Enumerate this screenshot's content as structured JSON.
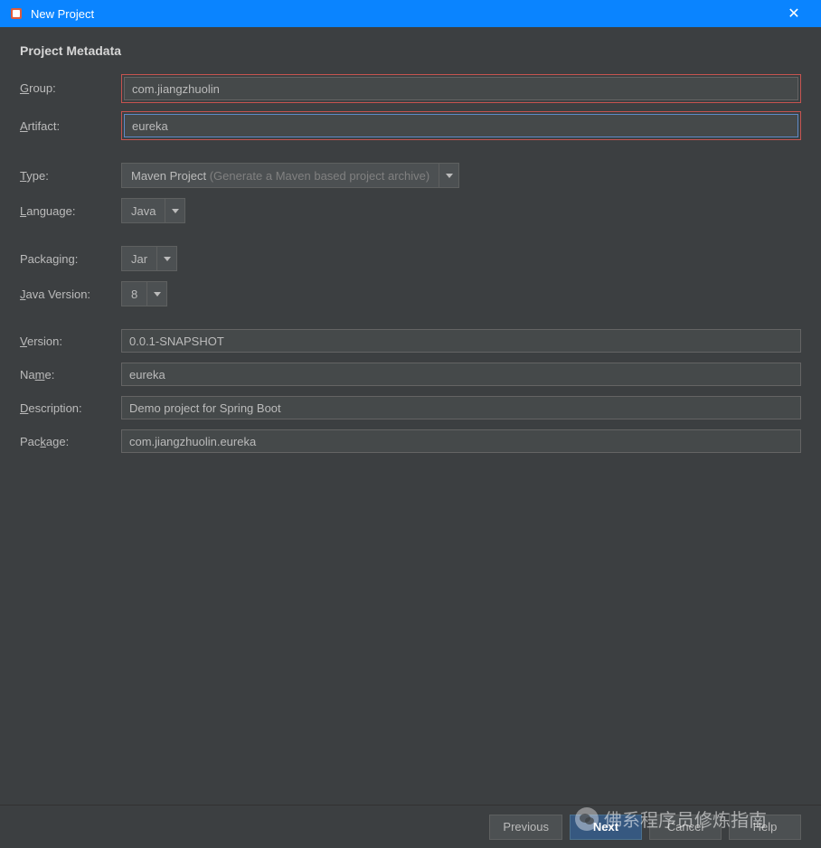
{
  "window": {
    "title": "New Project"
  },
  "section": {
    "title": "Project Metadata"
  },
  "labels": {
    "group": "Group:",
    "artifact": "Artifact:",
    "type": "Type:",
    "language": "Language:",
    "packaging": "Packaging:",
    "javaVersion": "Java Version:",
    "version": "Version:",
    "name": "Name:",
    "description": "Description:",
    "package": "Package:"
  },
  "fields": {
    "group": "com.jiangzhuolin",
    "artifact": "eureka",
    "type": "Maven Project",
    "typeHint": "(Generate a Maven based project archive)",
    "language": "Java",
    "packaging": "Jar",
    "javaVersion": "8",
    "version": "0.0.1-SNAPSHOT",
    "name": "eureka",
    "description": "Demo project for Spring Boot",
    "package": "com.jiangzhuolin.eureka"
  },
  "buttons": {
    "previous": "Previous",
    "next": "Next",
    "cancel": "Cancel",
    "help": "Help"
  },
  "watermark": "佛系程序员修炼指南"
}
